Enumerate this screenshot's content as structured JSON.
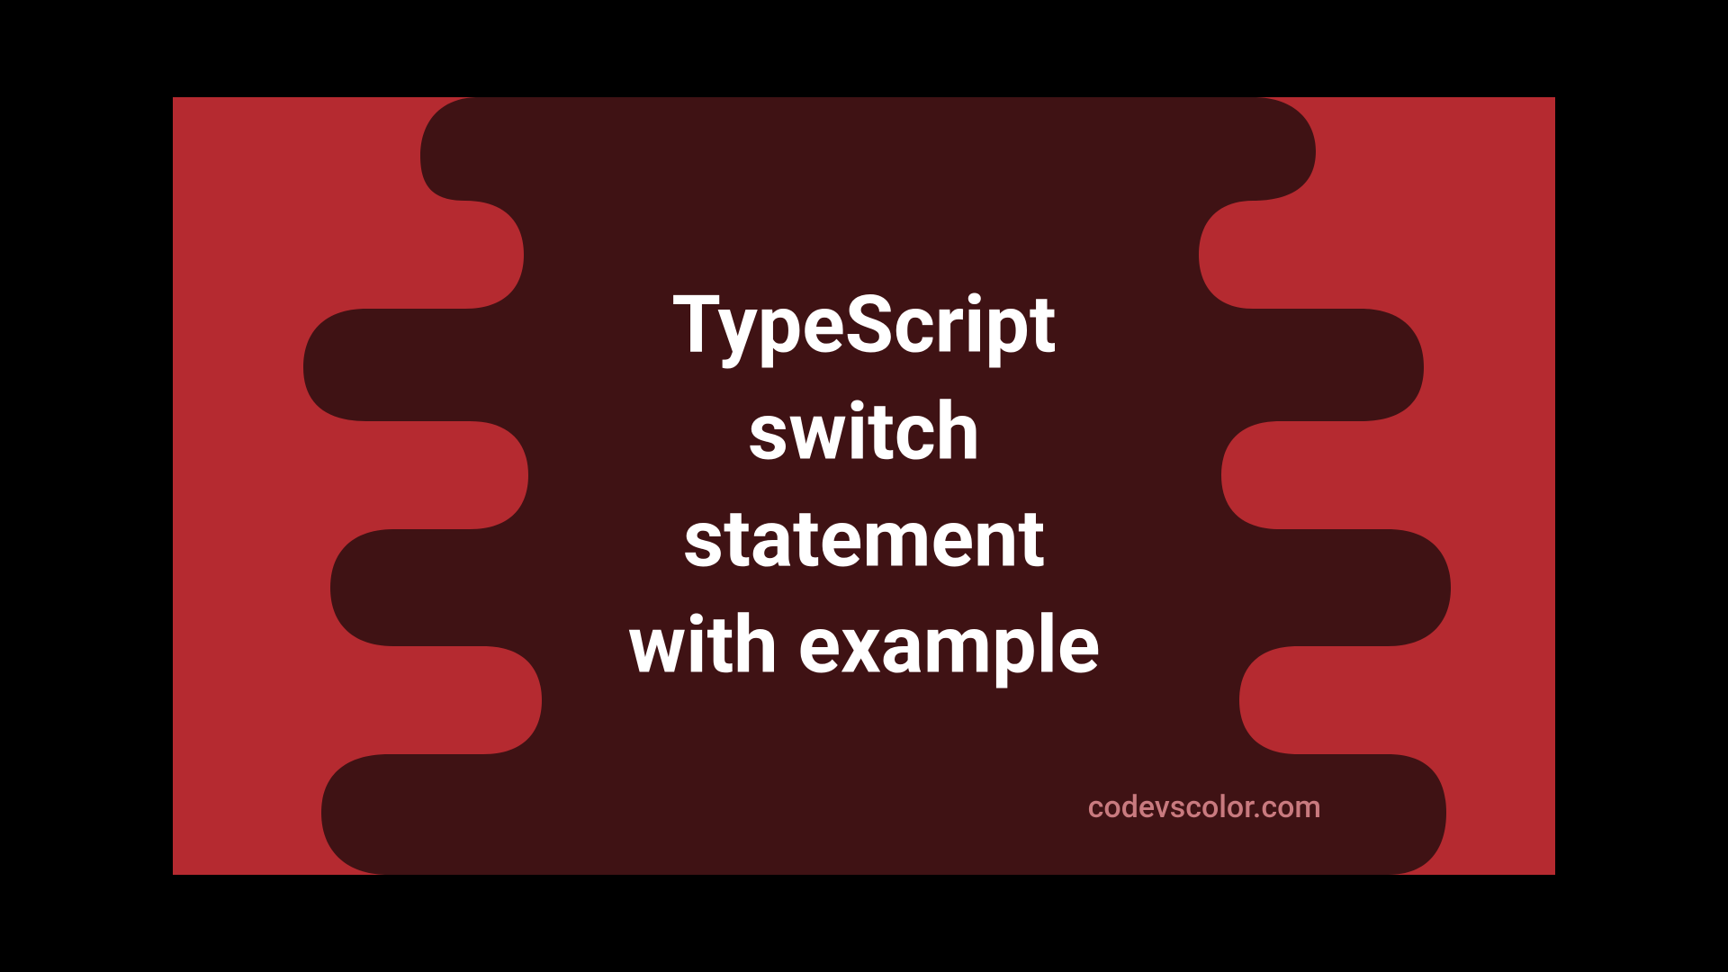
{
  "title": "TypeScript\nswitch\nstatement\nwith example",
  "watermark": "codevscolor.com",
  "colors": {
    "background": "#b52a30",
    "blob": "#3f1214",
    "text": "#ffffff",
    "watermark": "#c97a7f"
  }
}
